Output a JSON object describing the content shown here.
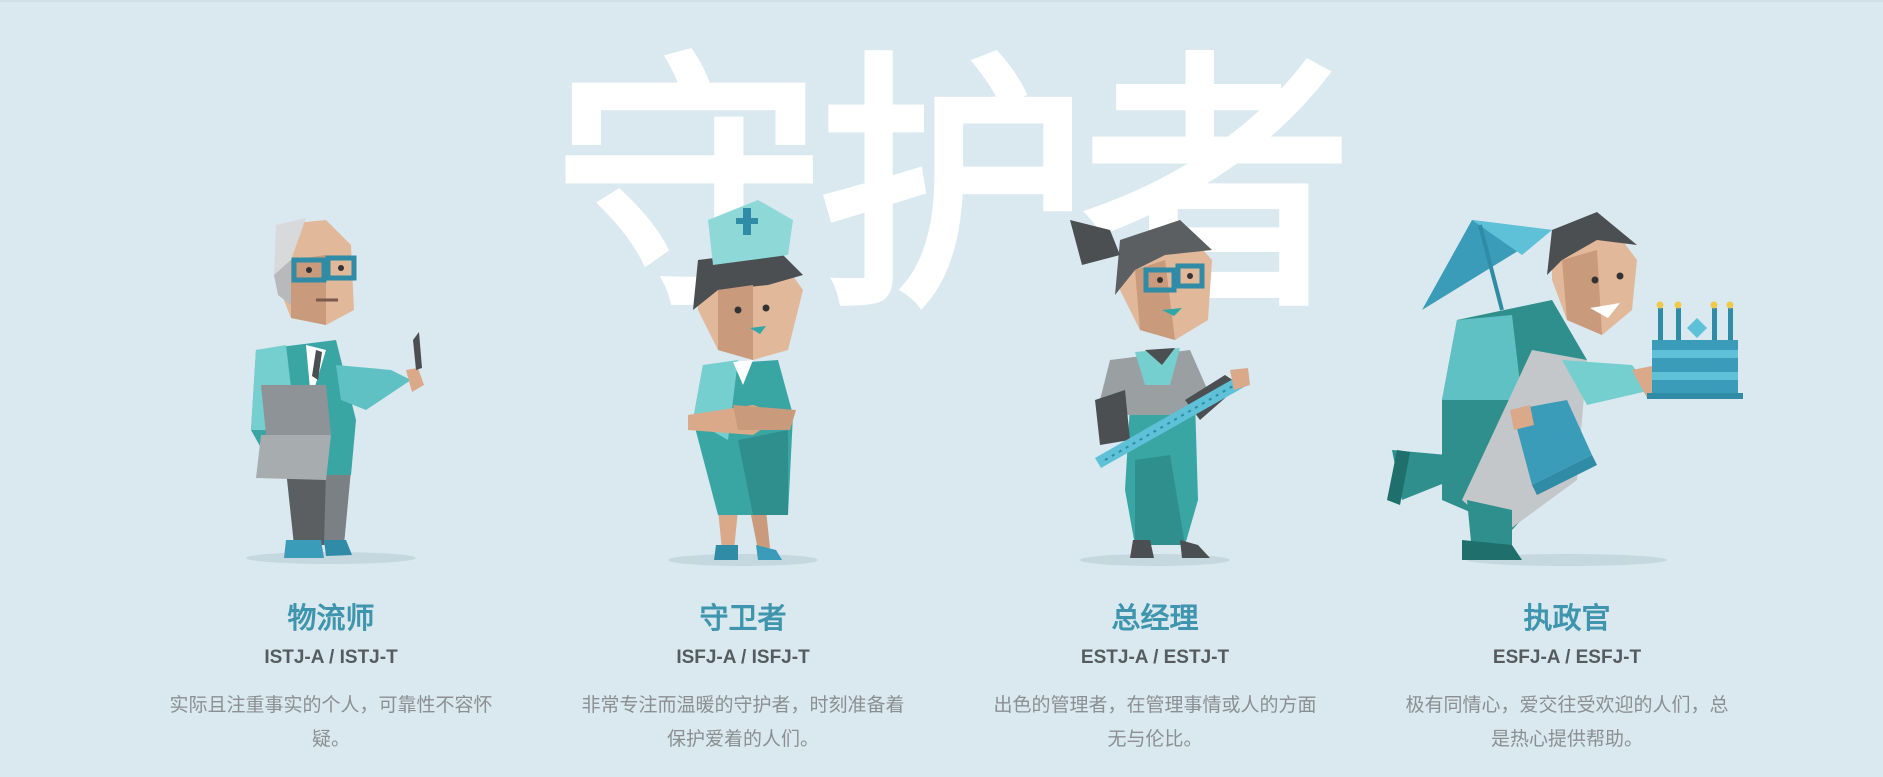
{
  "page": {
    "title": "守护者"
  },
  "types": [
    {
      "name": "物流师",
      "code": "ISTJ-A / ISTJ-T",
      "description": "实际且注重事实的个人，可靠性不容怀疑。"
    },
    {
      "name": "守卫者",
      "code": "ISFJ-A / ISFJ-T",
      "description": "非常专注而温暖的守护者，时刻准备着保护爱着的人们。"
    },
    {
      "name": "总经理",
      "code": "ESTJ-A / ESTJ-T",
      "description": "出色的管理者，在管理事情或人的方面无与伦比。"
    },
    {
      "name": "执政官",
      "code": "ESFJ-A / ESFJ-T",
      "description": "极有同情心，爱交往受欢迎的人们，总是热心提供帮助。"
    }
  ],
  "colors": {
    "background": "#d9e9ef",
    "accent": "#3f95ad",
    "teal": "#3aa6a4",
    "skin": "#d9a98a"
  }
}
